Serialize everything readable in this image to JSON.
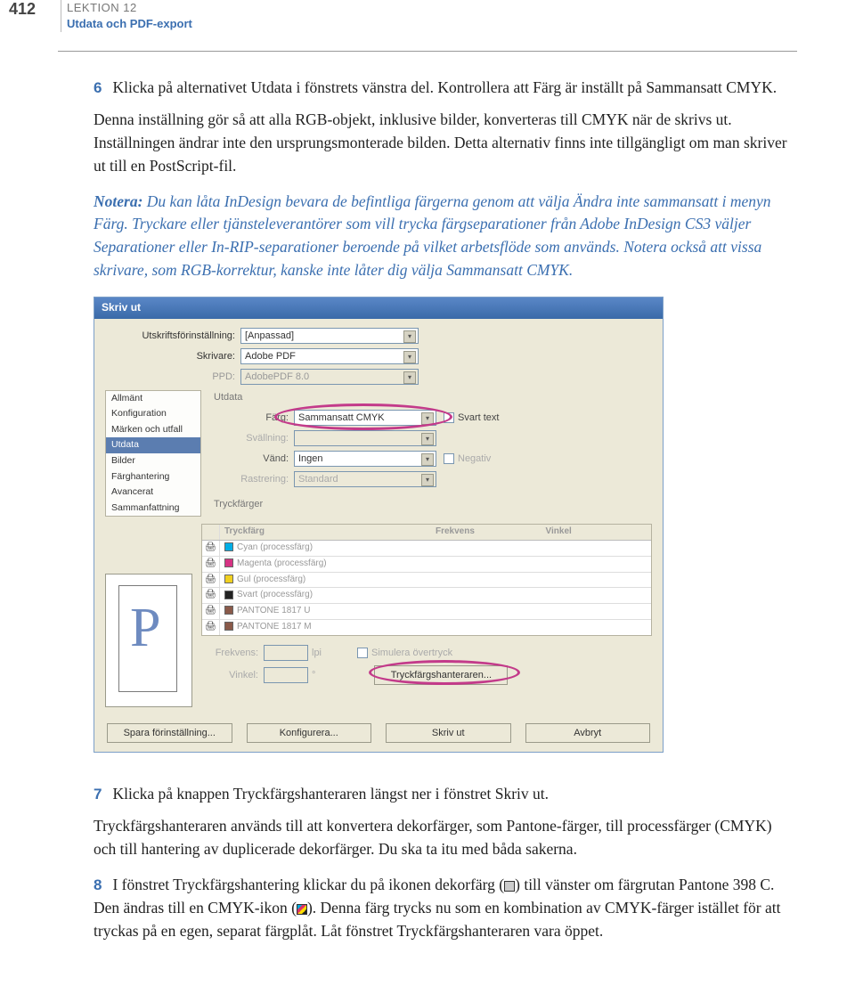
{
  "header": {
    "page_number": "412",
    "lesson_label": "LEKTION 12",
    "lesson_title": "Utdata och PDF-export"
  },
  "steps": {
    "s6": {
      "num": "6",
      "p1": "Klicka på alternativet Utdata i fönstrets vänstra del. Kontrollera att Färg är inställt på Sammansatt CMYK.",
      "p2": "Denna inställning gör så att alla RGB-objekt, inklusive bilder, konverteras till CMYK när de skrivs ut. Inställningen ändrar inte den ursprungsmonterade bilden. Detta alternativ finns inte tillgängligt om man skriver ut till en PostScript-fil."
    },
    "note": {
      "label": "Notera:",
      "text": " Du kan låta InDesign bevara de befintliga färgerna genom att välja Ändra inte sammansatt i menyn Färg. Tryckare eller tjänsteleverantörer som vill trycka färgseparationer från Adobe InDesign CS3 väljer Separationer eller In-RIP-separationer beroende på vilket arbetsflöde som används. Notera också att vissa skrivare, som RGB-korrektur, kanske inte låter dig välja Sammansatt CMYK."
    },
    "s7": {
      "num": "7",
      "p1": "Klicka på knappen Tryckfärgshanteraren längst ner i fönstret Skriv ut.",
      "p2": "Tryckfärgshanteraren används till att konvertera dekorfärger, som Pantone-färger, till processfärger (CMYK) och till hantering av duplicerade dekorfärger. Du ska ta itu med båda sakerna."
    },
    "s8": {
      "num": "8",
      "p1b": "I fönstret Tryckfärgshantering klickar du på ikonen dekorfärg (",
      "p1c": ") till vänster om färgrutan Pantone 398 C. Den ändras till en CMYK-ikon  (",
      "p1d": "). Denna färg trycks nu som en kombination av CMYK-färger istället för att tryckas på en egen, separat färgplåt. Låt fönstret Tryckfärgshanteraren vara öppet."
    }
  },
  "dialog": {
    "title": "Skriv ut",
    "preset_label": "Utskriftsförinställning:",
    "preset_value": "[Anpassad]",
    "printer_label": "Skrivare:",
    "printer_value": "Adobe PDF",
    "ppd_label": "PPD:",
    "ppd_value": "AdobePDF 8.0",
    "side_items": [
      "Allmänt",
      "Konfiguration",
      "Märken och utfall",
      "Utdata",
      "Bilder",
      "Färghantering",
      "Avancerat",
      "Sammanfattning"
    ],
    "panel_title": "Utdata",
    "color_label": "Färg:",
    "color_value": "Sammansatt CMYK",
    "blacktext_label": "Svart text",
    "overprint_label": "Svällning:",
    "flip_label": "Vänd:",
    "flip_value": "Ingen",
    "negative_label": "Negativ",
    "raster_label": "Rastrering:",
    "raster_value": "Standard",
    "inks_title": "Tryckfärger",
    "col_ink": "Tryckfärg",
    "col_freq": "Frekvens",
    "col_ang": "Vinkel",
    "inks": [
      {
        "name": "Cyan (processfärg)",
        "color": "#00aee6"
      },
      {
        "name": "Magenta (processfärg)",
        "color": "#d63384"
      },
      {
        "name": "Gul (processfärg)",
        "color": "#f0d020"
      },
      {
        "name": "Svart (processfärg)",
        "color": "#222"
      },
      {
        "name": "PANTONE 1817 U",
        "color": "#8a5a4a"
      },
      {
        "name": "PANTONE 1817 M",
        "color": "#8a5a4a"
      }
    ],
    "freq_label": "Frekvens:",
    "freq_unit": "lpi",
    "angle_label": "Vinkel:",
    "angle_unit": "°",
    "sim_over_label": "Simulera övertryck",
    "inkmgr_btn": "Tryckfärgshanteraren...",
    "btn_save": "Spara förinställning...",
    "btn_conf": "Konfigurera...",
    "btn_print": "Skriv ut",
    "btn_cancel": "Avbryt",
    "preview_letter": "P"
  }
}
